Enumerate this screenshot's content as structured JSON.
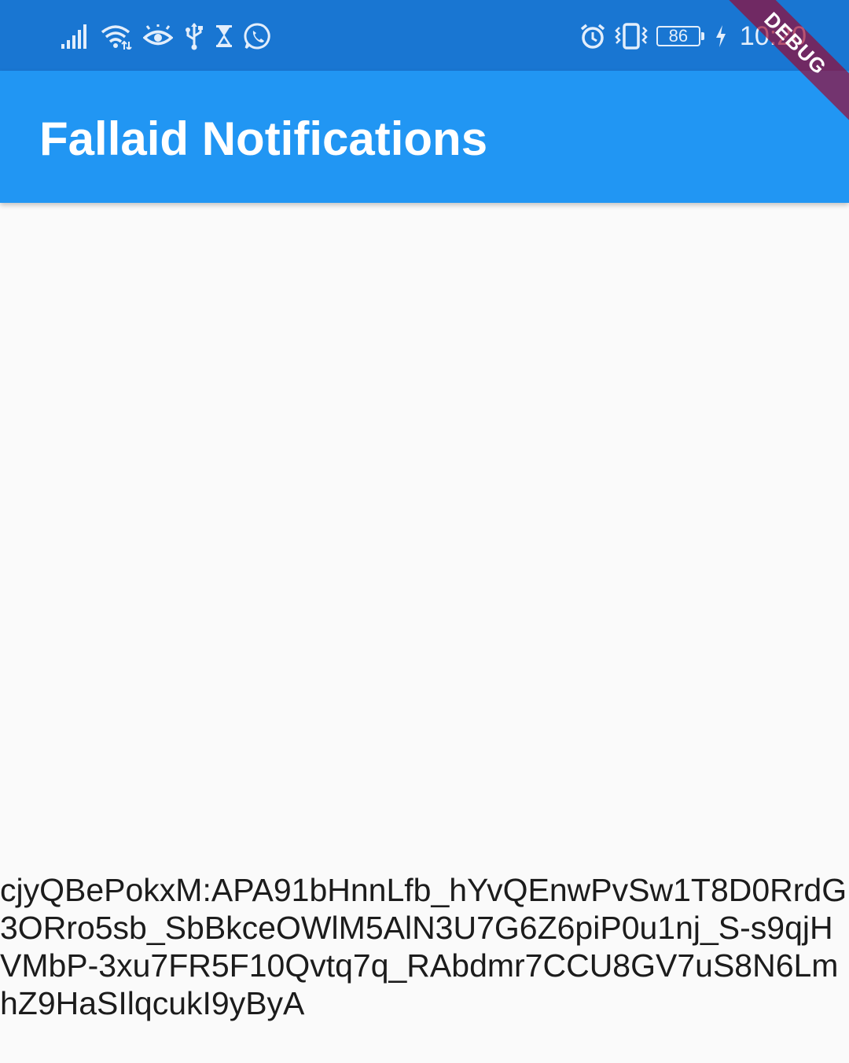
{
  "status_bar": {
    "left_icons": [
      "signal-icon",
      "wifi-icon",
      "eye-icon",
      "usb-icon",
      "hourglass-icon",
      "whatsapp-icon"
    ],
    "right_icons": [
      "alarm-icon",
      "vibrate-icon",
      "battery-icon",
      "charging-icon"
    ],
    "battery_level": "86",
    "time": "10:20"
  },
  "app_bar": {
    "title": "Fallaid Notifications"
  },
  "debug_banner": {
    "label": "DEBUG"
  },
  "body": {
    "token": "cjyQBePokxM:APA91bHnnLfb_hYvQEnwPvSw1T8D0RrdG3ORro5sb_SbBkceOWlM5AlN3U7G6Z6piP0u1nj_S-s9qjHVMbP-3xu7FR5F10Qvtq7q_RAbdmr7CCU8GV7uS8N6LmhZ9HaSIlqcukI9yByA"
  },
  "colors": {
    "status_bar": "#1976d2",
    "app_bar": "#2196f3",
    "background": "#fafafa",
    "debug_banner": "#a00028"
  }
}
